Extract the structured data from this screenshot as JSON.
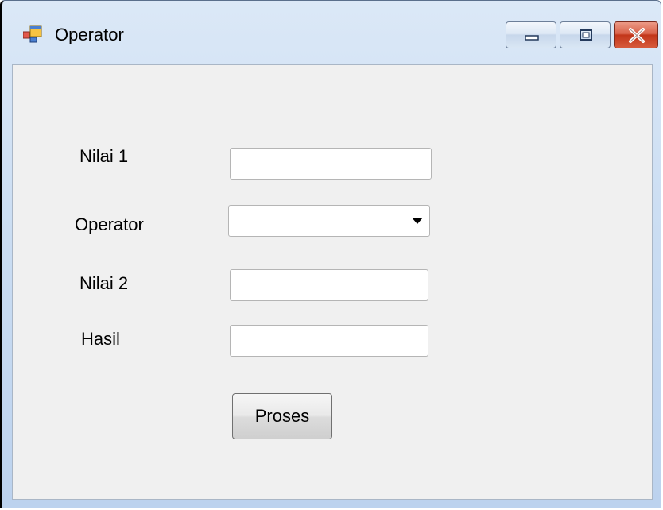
{
  "window": {
    "title": "Operator",
    "icon": "windows-form-icon",
    "controls": {
      "minimize_icon": "minimize-icon",
      "maximize_icon": "maximize-icon",
      "close_icon": "close-icon"
    }
  },
  "form": {
    "nilai1": {
      "label": "Nilai 1",
      "value": ""
    },
    "operator": {
      "label": "Operator",
      "value": "",
      "icon": "chevron-down-icon"
    },
    "nilai2": {
      "label": "Nilai 2",
      "value": ""
    },
    "hasil": {
      "label": "Hasil",
      "value": ""
    },
    "submit_label": "Proses"
  },
  "colors": {
    "titlebar": "#c9dcf2",
    "client": "#f0f0f0",
    "close_button": "#c2361a"
  }
}
